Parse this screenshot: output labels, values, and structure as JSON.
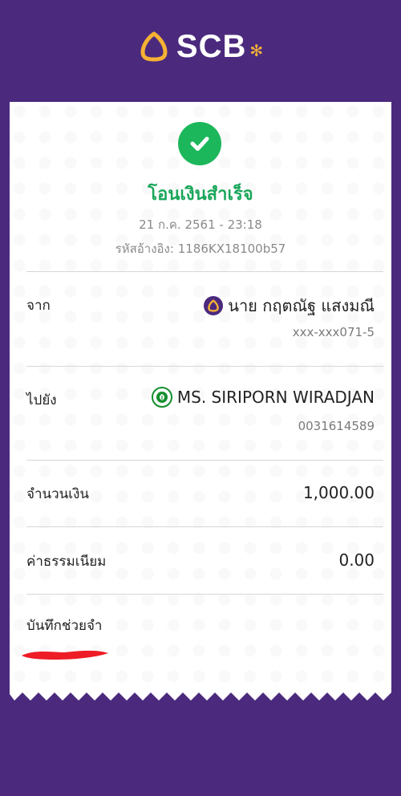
{
  "header": {
    "brand": "SCB",
    "logo_icon": "scb-shell-icon",
    "star_icon": "asterisk-star-icon"
  },
  "colors": {
    "brand_purple": "#4b2a7e",
    "success_green": "#1db75b",
    "brand_gold": "#f5b234"
  },
  "receipt": {
    "status_icon": "check-circle-icon",
    "title": "โอนเงินสำเร็จ",
    "datetime": "21 ก.ค. 2561 - 23:18",
    "reference": "รหัสอ้างอิง: 1186KX18100b57",
    "from": {
      "label": "จาก",
      "bank_icon": "scb-bank-icon",
      "name": "นาย กฤตณัฐ แสงมณี",
      "account": "xxx-xxx071-5"
    },
    "to": {
      "label": "ไปยัง",
      "bank_icon": "kbank-bank-icon",
      "name": "MS. SIRIPORN WIRADJAN",
      "account": "0031614589"
    },
    "amount": {
      "label": "จำนวนเงิน",
      "value": "1,000.00"
    },
    "fee": {
      "label": "ค่าธรรมเนียม",
      "value": "0.00"
    },
    "memo": {
      "label": "บันทึกช่วยจำ"
    }
  }
}
